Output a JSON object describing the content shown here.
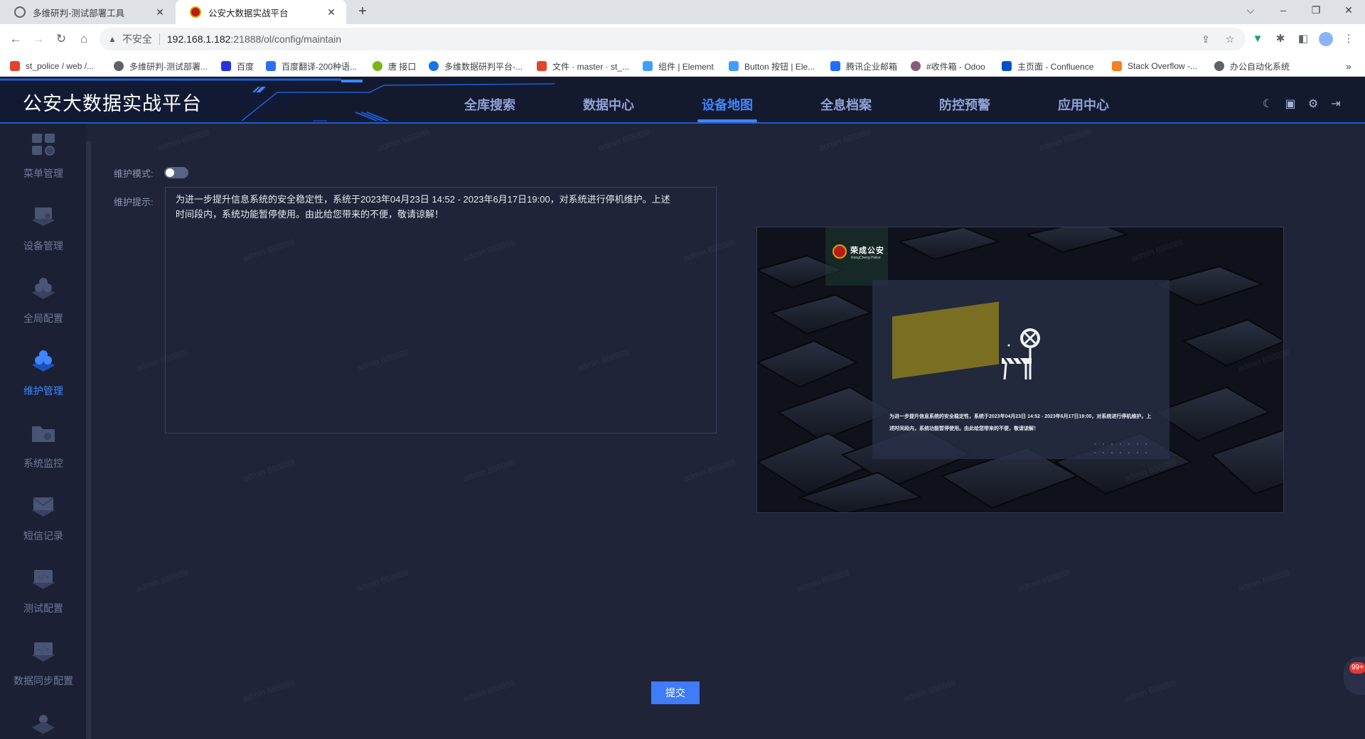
{
  "browser": {
    "tabs": [
      {
        "title": "多维研判-测试部署工具",
        "close": "✕"
      },
      {
        "title": "公安大数据实战平台",
        "close": "✕"
      }
    ],
    "new_tab": "+",
    "window_controls": [
      "⌵",
      "–",
      "❐",
      "✕"
    ],
    "security_label": "不安全",
    "url_host": "192.168.1.182",
    "url_path": ":21888/ol/config/maintain",
    "bookmarks": [
      {
        "label": "st_police / web /...",
        "color": "#e24329"
      },
      {
        "label": "多维研判-测试部署...",
        "color": "#5f6368"
      },
      {
        "label": "百度",
        "color": "#2932e1"
      },
      {
        "label": "百度翻译-200种语...",
        "color": "#2b6ff4"
      },
      {
        "label": "唐 接口",
        "color": "#7cb518"
      },
      {
        "label": "多维数据研判平台-...",
        "color": "#1a73e8"
      },
      {
        "label": "文件 · master · st_...",
        "color": "#e24329"
      },
      {
        "label": "组件 | Element",
        "color": "#409eff"
      },
      {
        "label": "Button 按钮 | Ele...",
        "color": "#409eff"
      },
      {
        "label": "腾讯企业邮箱",
        "color": "#1e6fff"
      },
      {
        "label": "#收件箱 - Odoo",
        "color": "#875a7b"
      },
      {
        "label": "主页面 - Confluence",
        "color": "#0052cc"
      },
      {
        "label": "Stack Overflow -...",
        "color": "#f48024"
      },
      {
        "label": "办公自动化系统",
        "color": "#5f6368"
      }
    ],
    "bookmarks_more": "»"
  },
  "app": {
    "brand": "公安大数据实战平台",
    "topnav": [
      "全库搜索",
      "数据中心",
      "设备地图",
      "全息档案",
      "防控预警",
      "应用中心"
    ],
    "topnav_active": "设备地图",
    "accent": "#3f86ff"
  },
  "sidebar": {
    "items": [
      {
        "label": "菜单管理",
        "icon": "menu-manage-icon"
      },
      {
        "label": "设备管理",
        "icon": "device-manage-icon"
      },
      {
        "label": "全局配置",
        "icon": "global-config-icon"
      },
      {
        "label": "维护管理",
        "icon": "maintenance-icon",
        "active": true
      },
      {
        "label": "系统监控",
        "icon": "system-monitor-icon"
      },
      {
        "label": "短信记录",
        "icon": "sms-record-icon"
      },
      {
        "label": "测试配置",
        "icon": "test-config-icon"
      },
      {
        "label": "数据同步配置",
        "icon": "data-sync-icon"
      }
    ]
  },
  "form": {
    "mode_label": "维护模式:",
    "mode_on": false,
    "notice_label": "维护提示:",
    "notice_text": "为进一步提升信息系统的安全稳定性，系统于2023年04月23日 14:52 - 2023年6月17日19:00，对系统进行停机维护。上述时间段内，系统功能暂停使用。由此给您带来的不便，敬请谅解！",
    "submit_label": "提交"
  },
  "preview": {
    "logo_cn": "荣成公安",
    "logo_en": "RongCheng Police",
    "card_text": "为进一步提升信息系统的安全稳定性，系统于2023年04月23日 14:52 - 2023年6月17日19:00，对系统进行停机维护。上述时间段内，系统功能暂停使用。由此给您带来的不便，敬请谅解！"
  },
  "watermark": "admin 888888",
  "floating_badge": "99+"
}
